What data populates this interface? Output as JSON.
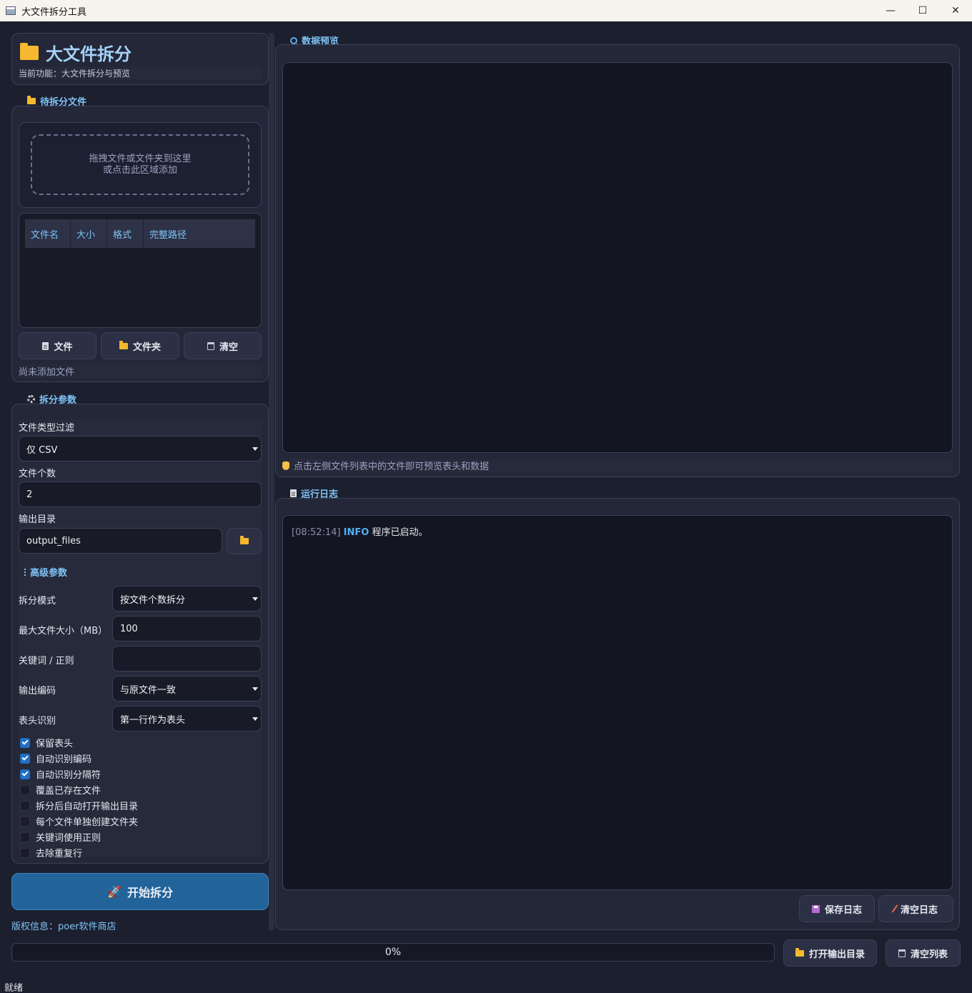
{
  "window": {
    "title": "大文件拆分工具",
    "minimize": "—",
    "maximize": "☐",
    "close": "✕"
  },
  "header": {
    "title": "大文件拆分",
    "subtitle": "当前功能：大文件拆分与预览"
  },
  "files": {
    "section_label": "待拆分文件",
    "dropzone_line1": "拖拽文件或文件夹到这里",
    "dropzone_line2": "或点击此区域添加",
    "columns": [
      "文件名",
      "大小",
      "格式",
      "完整路径"
    ],
    "btn_file": "文件",
    "btn_folder": "文件夹",
    "btn_clear": "清空",
    "status": "尚未添加文件"
  },
  "params": {
    "section_label": "拆分参数",
    "type_filter_label": "文件类型过滤",
    "type_filter_value": "仅 CSV",
    "file_count_label": "文件个数",
    "file_count_value": "2",
    "output_dir_label": "输出目录",
    "output_dir_value": "output_files",
    "advanced_label": "高级参数",
    "split_mode_label": "拆分模式",
    "split_mode_value": "按文件个数拆分",
    "max_size_label": "最大文件大小（MB）",
    "max_size_value": "100",
    "keyword_label": "关键词 / 正则",
    "keyword_value": "",
    "encoding_label": "输出编码",
    "encoding_value": "与原文件一致",
    "header_detect_label": "表头识别",
    "header_detect_value": "第一行作为表头",
    "checkboxes": [
      {
        "label": "保留表头",
        "checked": true
      },
      {
        "label": "自动识别编码",
        "checked": true
      },
      {
        "label": "自动识别分隔符",
        "checked": true
      },
      {
        "label": "覆盖已存在文件",
        "checked": false
      },
      {
        "label": "拆分后自动打开输出目录",
        "checked": false
      },
      {
        "label": "每个文件单独创建文件夹",
        "checked": false
      },
      {
        "label": "关键词使用正则",
        "checked": false
      },
      {
        "label": "去除重复行",
        "checked": false
      }
    ]
  },
  "start_button": "开始拆分",
  "copyright": "版权信息：poer软件商店",
  "preview": {
    "section_label": "数据预览",
    "hint": "点击左侧文件列表中的文件即可预览表头和数据"
  },
  "log": {
    "section_label": "运行日志",
    "entries": [
      {
        "time": "[08:52:14]",
        "level": "INFO",
        "message": "程序已启动。"
      }
    ],
    "btn_save": "保存日志",
    "btn_clear": "清空日志"
  },
  "progress": {
    "value": 0,
    "text": "0%"
  },
  "bottom": {
    "btn_open_output": "打开输出目录",
    "btn_clear_list": "清空列表"
  },
  "statusbar": "就绪",
  "colors": {
    "accent": "#7fc4f7",
    "background": "#1c1f2e",
    "start_button": "#22639a",
    "checkbox_on": "#1f6fc4"
  }
}
